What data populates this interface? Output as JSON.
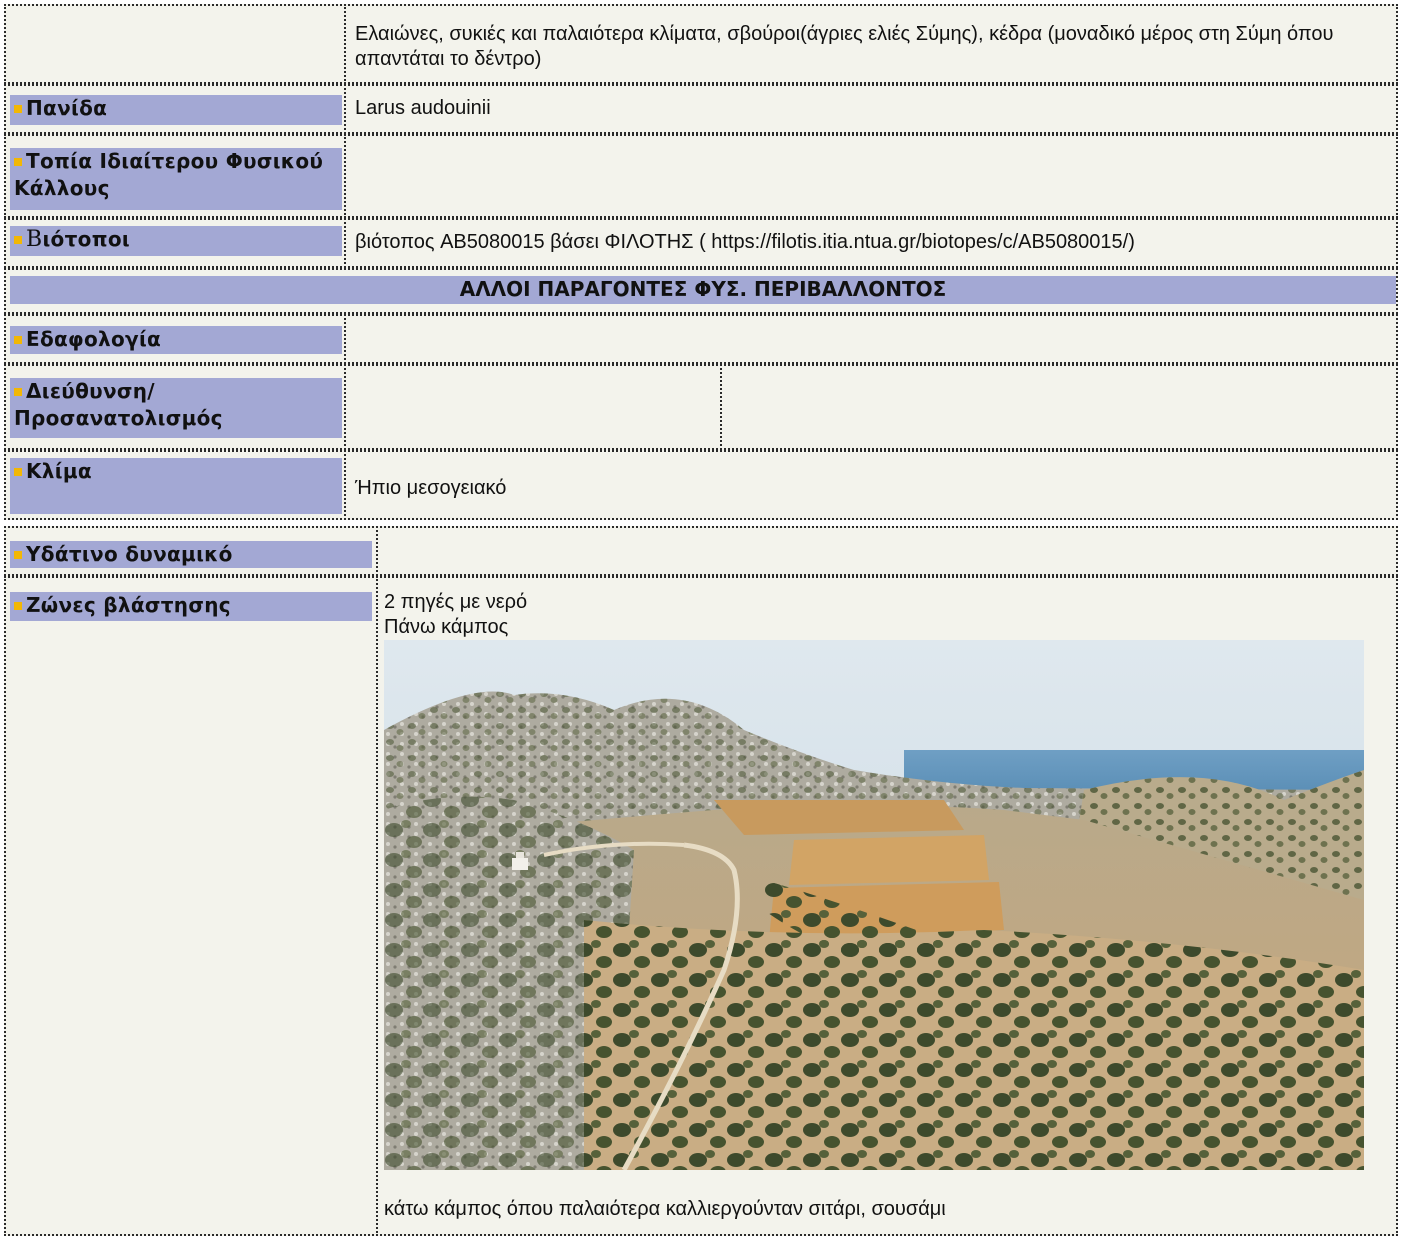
{
  "rows": {
    "flora": {
      "text": "Ελαιώνες, συκιές και παλαιότερα κλίματα, σβούροι(άγριες ελιές Σύμης), κέδρα (μοναδικό μέρος στη Σύμη όπου απαντάται το δέντρο)"
    },
    "fauna": {
      "label": "Πανίδα",
      "text": "Larus audouinii"
    },
    "landscapes": {
      "label": "Τοπία Ιδιαίτερου Φυσικού Κάλλους",
      "text": ""
    },
    "biotopes": {
      "label_initial": "Β",
      "label_rest": "ιότοποι",
      "text": "βιότοπος AB5080015 βάσει ΦΙΛΟΤΗΣ ( https://filotis.itia.ntua.gr/biotopes/c/AB5080015/)"
    },
    "section_header": "ΑΛΛΟΙ ΠΑΡΑΓΟΝΤΕΣ ΦΥΣ. ΠΕΡΙΒΑΛΛΟΝΤΟΣ",
    "soil": {
      "label": "Εδαφολογία",
      "text": ""
    },
    "orientation": {
      "label": "Διεύθυνση/ Προσανατολισμός",
      "text_a": "",
      "text_b": ""
    },
    "climate": {
      "label": "Κλίμα",
      "text": "Ήπιο μεσογειακό"
    },
    "water": {
      "label": "Υδάτινο δυναμικό",
      "text": ""
    },
    "vegetation": {
      "label": "Ζώνες βλάστησης",
      "line1": "2 πηγές με νερό",
      "line2": "Πάνω κάμπος",
      "caption": "κάτω κάμπος όπου παλαιότερα καλλιεργούνταν σιτάρι, σουσάμι"
    }
  },
  "colors": {
    "label_bg": "#a3a8d4",
    "cell_bg": "#f3f3ec",
    "bullet": "#f2b705"
  },
  "photo": {
    "subject": "aerial-landscape-fields-olive-groves"
  }
}
